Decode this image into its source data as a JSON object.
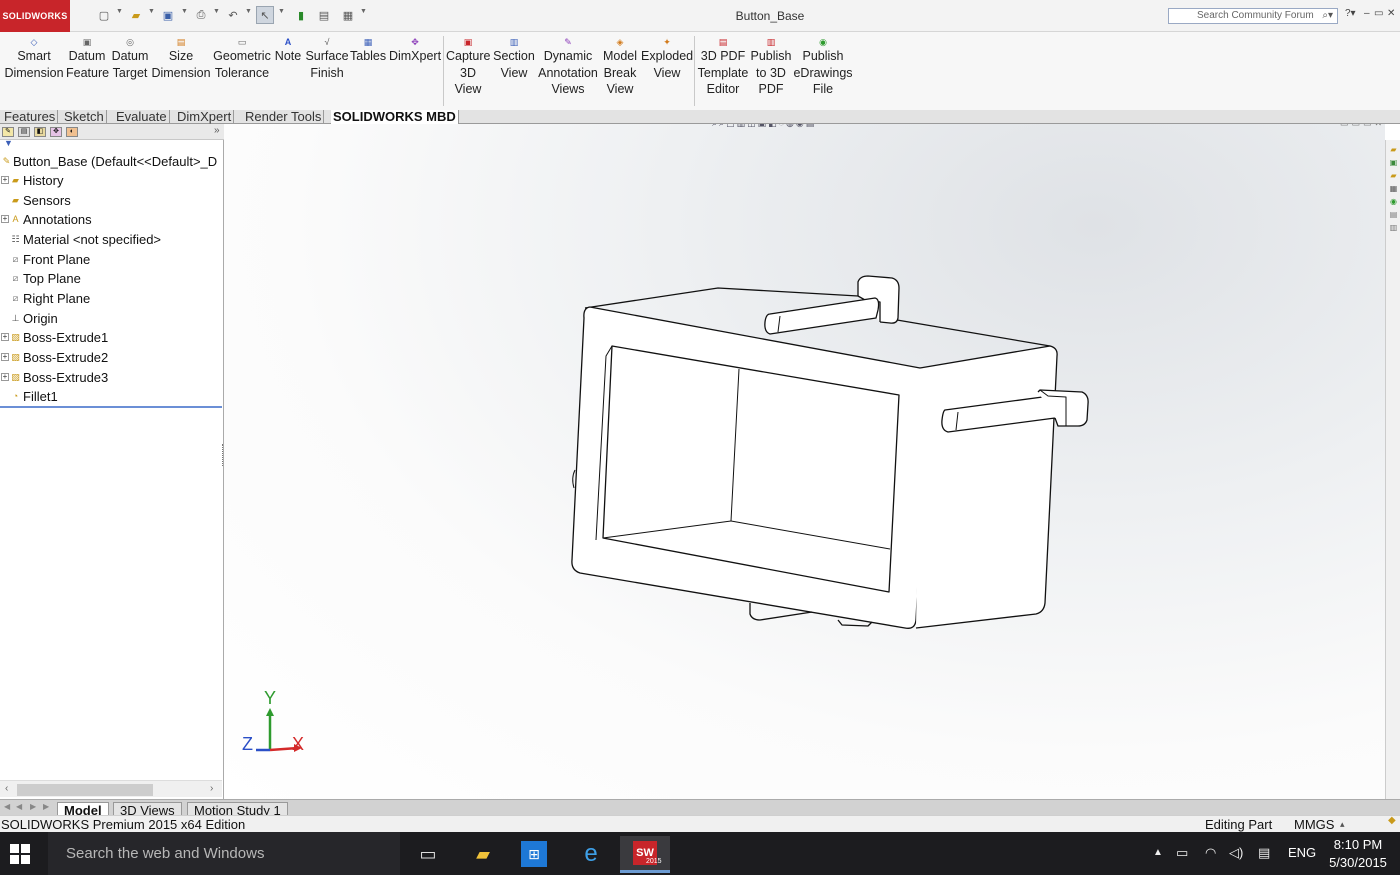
{
  "app": {
    "logo_text": "SOLIDWORKS",
    "document_title": "Button_Base"
  },
  "search": {
    "placeholder": "Search Community Forum"
  },
  "ribbon": {
    "groups": [
      {
        "lines": [
          "Smart",
          "Dimension"
        ],
        "icon": "smart-dimension-icon"
      },
      {
        "lines": [
          "Datum",
          "Feature"
        ],
        "icon": "datum-feature-icon"
      },
      {
        "lines": [
          "Datum",
          "Target"
        ],
        "icon": "datum-target-icon"
      },
      {
        "lines": [
          "Size",
          "Dimension"
        ],
        "icon": "size-dimension-icon"
      },
      {
        "lines": [
          "Geometric",
          "Tolerance"
        ],
        "icon": "geometric-tolerance-icon"
      },
      {
        "lines": [
          "Note"
        ],
        "icon": "note-icon"
      },
      {
        "lines": [
          "Surface",
          "Finish"
        ],
        "icon": "surface-finish-icon"
      },
      {
        "lines": [
          "Tables"
        ],
        "icon": "tables-icon"
      },
      {
        "lines": [
          "DimXpert"
        ],
        "icon": "dimxpert-icon"
      },
      {
        "lines": [
          "Capture",
          "3D",
          "View"
        ],
        "icon": "capture-3d-view-icon"
      },
      {
        "lines": [
          "Section",
          "View"
        ],
        "icon": "section-view-icon"
      },
      {
        "lines": [
          "Dynamic",
          "Annotation",
          "Views"
        ],
        "icon": "dynamic-annotation-icon"
      },
      {
        "lines": [
          "Model",
          "Break",
          "View"
        ],
        "icon": "model-break-icon"
      },
      {
        "lines": [
          "Exploded",
          "View"
        ],
        "icon": "exploded-view-icon"
      },
      {
        "lines": [
          "3D PDF",
          "Template",
          "Editor"
        ],
        "icon": "pdf-template-icon"
      },
      {
        "lines": [
          "Publish",
          "to 3D",
          "PDF"
        ],
        "icon": "publish-pdf-icon"
      },
      {
        "lines": [
          "Publish",
          "eDrawings",
          "File"
        ],
        "icon": "edrawings-icon"
      }
    ]
  },
  "tabs": [
    "Features",
    "Sketch",
    "Evaluate",
    "DimXpert",
    "Render Tools",
    "SOLIDWORKS MBD"
  ],
  "tree": {
    "root": "Button_Base  (Default<<Default>_D",
    "items": [
      {
        "label": "History",
        "expandable": true
      },
      {
        "label": "Sensors",
        "expandable": false
      },
      {
        "label": "Annotations",
        "expandable": true
      },
      {
        "label": "Material <not specified>",
        "expandable": false
      },
      {
        "label": "Front Plane",
        "expandable": false
      },
      {
        "label": "Top Plane",
        "expandable": false
      },
      {
        "label": "Right Plane",
        "expandable": false
      },
      {
        "label": "Origin",
        "expandable": false
      },
      {
        "label": "Boss-Extrude1",
        "expandable": true
      },
      {
        "label": "Boss-Extrude2",
        "expandable": true
      },
      {
        "label": "Boss-Extrude3",
        "expandable": true
      },
      {
        "label": "Fillet1",
        "expandable": false
      }
    ]
  },
  "triad": {
    "x": "X",
    "y": "Y",
    "z": "Z",
    "x_color": "#d42a2a",
    "y_color": "#2e9b2e",
    "z_color": "#2b4fc7"
  },
  "bottom_tabs": [
    "Model",
    "3D Views",
    "Motion Study 1"
  ],
  "status": {
    "app_edition": "SOLIDWORKS Premium 2015 x64 Edition",
    "mode": "Editing Part",
    "units": "MMGS"
  },
  "taskbar": {
    "search_placeholder": "Search the web and Windows",
    "language": "ENG",
    "time": "8:10 PM",
    "date": "5/30/2015",
    "sw_badge": "2015"
  },
  "colors": {
    "brand": "#c8252a",
    "taskbar": "#1c1c1f",
    "active_tab": "#ffffff"
  }
}
